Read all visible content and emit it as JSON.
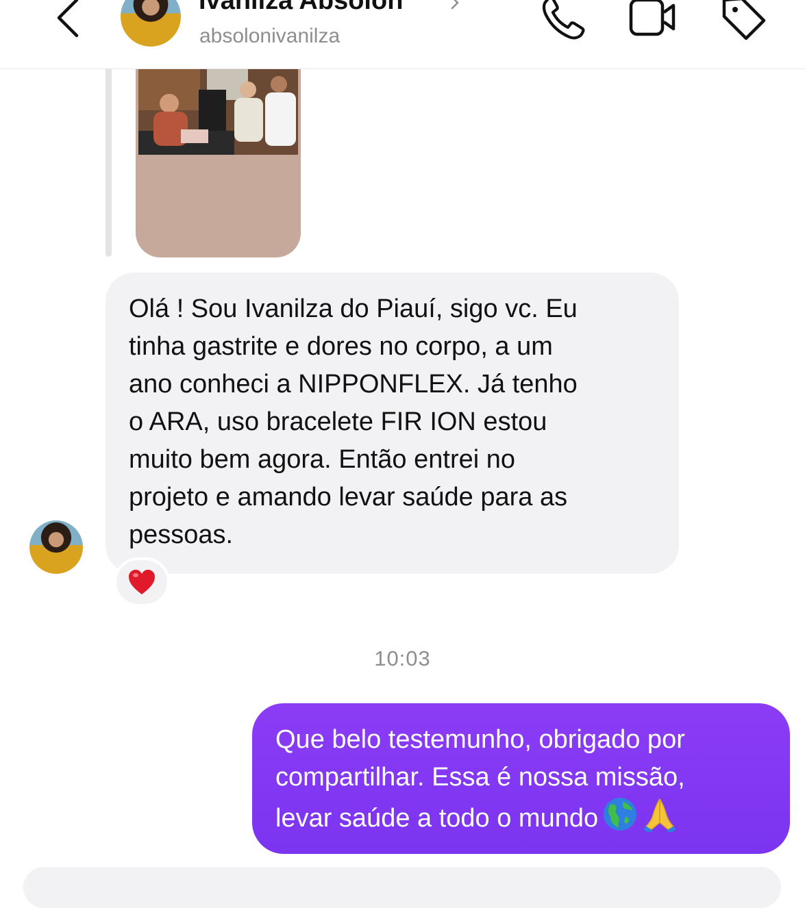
{
  "header": {
    "contact_name": "Ivanilza Absolon",
    "username": "absolonivanilza"
  },
  "messages": {
    "incoming_text": "Olá ! Sou Ivanilza do Piauí, sigo vc. Eu\ntinha gastrite e dores no corpo, a um\nano conheci a NIPPONFLEX.  Já tenho\no ARA, uso bracelete FIR ION  estou\nmuito bem agora. Então entrei no\nprojeto e amando levar saúde para as\npessoas.",
    "incoming_reaction": "heart",
    "timestamp": "10:03",
    "outgoing_text": "Que belo testemunho, obrigado por\ncompartilhar. Essa é nossa missão,\nlevar saúde a todo o mundo",
    "outgoing_emojis": [
      "globe-americas",
      "folded-hands"
    ]
  },
  "colors": {
    "outgoing_bubble": "#8b3cf5",
    "incoming_bubble": "#f2f2f4",
    "secondary_text": "#8e8e8e",
    "reaction_heart": "#e0192b"
  }
}
